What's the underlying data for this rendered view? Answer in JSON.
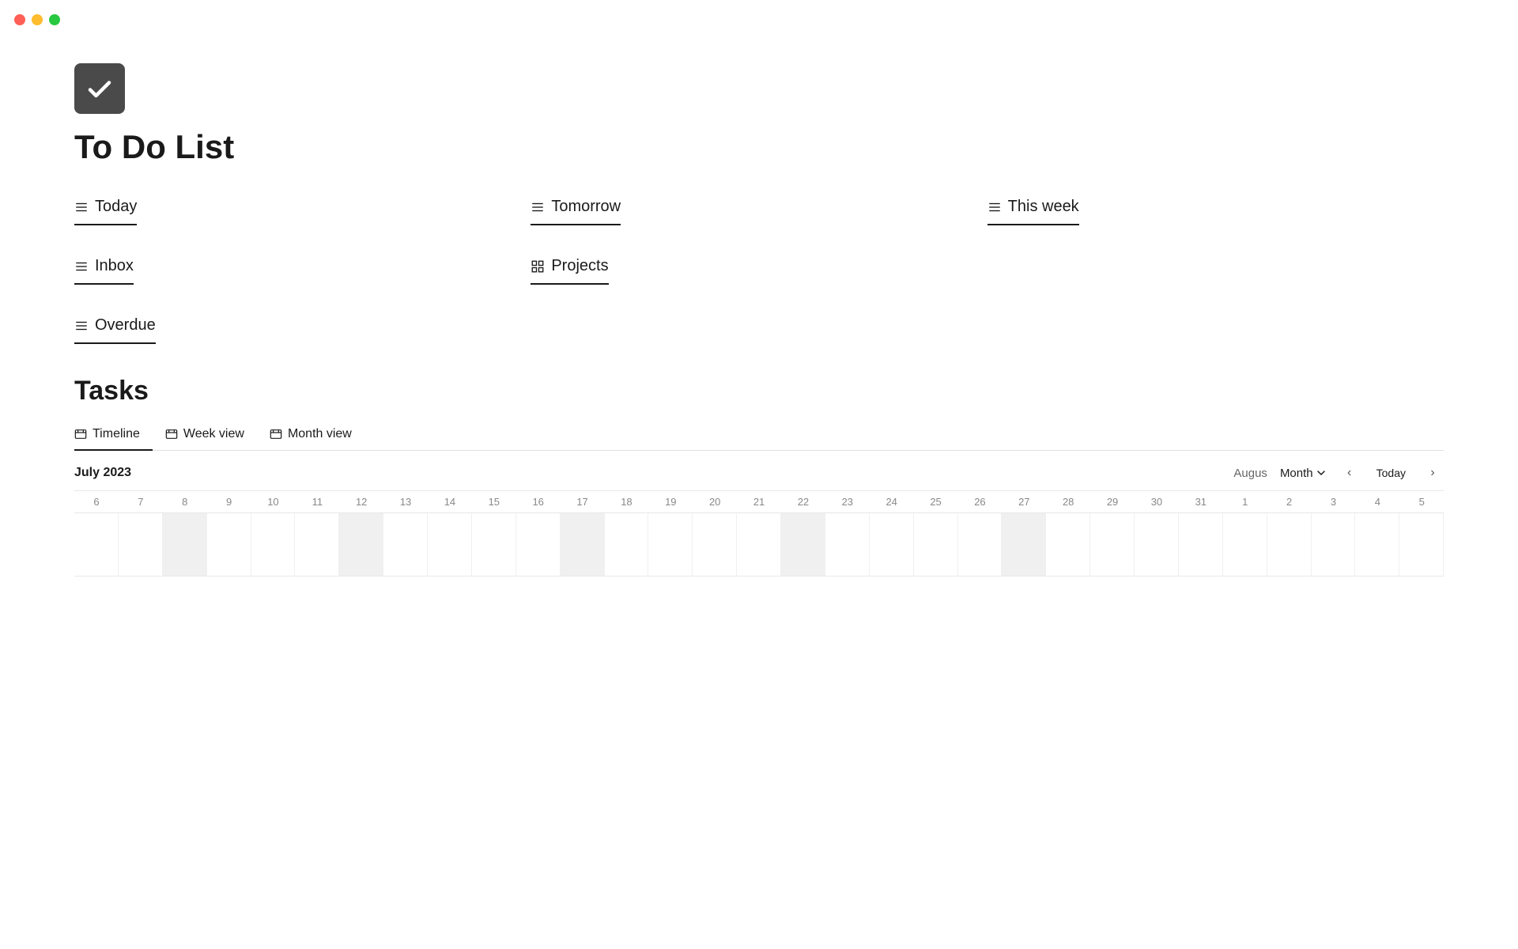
{
  "window": {
    "title": "To Do List"
  },
  "traffic_lights": {
    "red": "red",
    "yellow": "yellow",
    "green": "green"
  },
  "app_icon": {
    "alt": "checkmark icon"
  },
  "page_title": "To Do List",
  "sections_row1": [
    {
      "id": "today",
      "label": "Today",
      "icon": "list"
    },
    {
      "id": "tomorrow",
      "label": "Tomorrow",
      "icon": "list"
    },
    {
      "id": "this-week",
      "label": "This week",
      "icon": "list"
    }
  ],
  "sections_row2": [
    {
      "id": "inbox",
      "label": "Inbox",
      "icon": "list"
    },
    {
      "id": "projects",
      "label": "Projects",
      "icon": "grid"
    },
    {
      "id": "empty",
      "label": "",
      "icon": ""
    }
  ],
  "sections_row3": [
    {
      "id": "overdue",
      "label": "Overdue",
      "icon": "list"
    },
    {
      "id": "empty2",
      "label": "",
      "icon": ""
    },
    {
      "id": "empty3",
      "label": "",
      "icon": ""
    }
  ],
  "tasks": {
    "title": "Tasks",
    "view_tabs": [
      {
        "id": "timeline",
        "label": "Timeline",
        "icon": "timeline",
        "active": true
      },
      {
        "id": "week-view",
        "label": "Week view",
        "icon": "calendar-week",
        "active": false
      },
      {
        "id": "month-view",
        "label": "Month view",
        "icon": "calendar-month",
        "active": false
      }
    ],
    "timeline": {
      "current_month": "July 2023",
      "next_month_label": "Augus",
      "month_dropdown": "Month",
      "today_button": "Today",
      "dates": [
        "6",
        "7",
        "8",
        "9",
        "10",
        "11",
        "12",
        "13",
        "14",
        "15",
        "16",
        "17",
        "18",
        "19",
        "20",
        "21",
        "22",
        "23",
        "24",
        "25",
        "26",
        "27",
        "28",
        "29",
        "30",
        "31",
        "1",
        "2",
        "3",
        "4",
        "5"
      ],
      "filled_cells": [
        2,
        6,
        11,
        16,
        21
      ]
    }
  }
}
